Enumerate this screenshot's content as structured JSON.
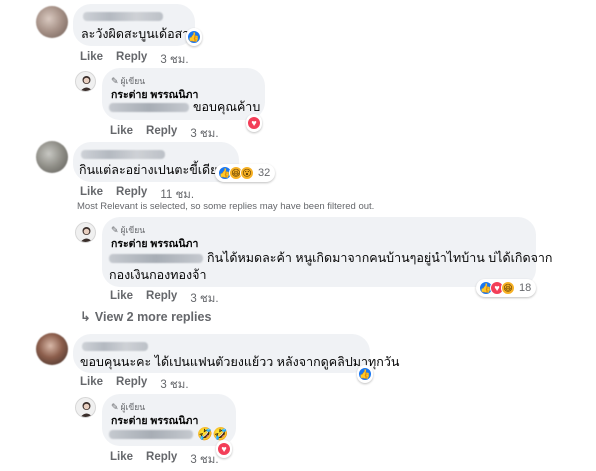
{
  "labels": {
    "like": "Like",
    "reply": "Reply",
    "author_badge": "ผู้เขียน",
    "author_name": "กระต่าย พรรณนิภา"
  },
  "comments": [
    {
      "text": "ละวังผิดสะบูนเด้อสาว",
      "time": "3 ชม.",
      "reactions": [
        "like"
      ],
      "reaction_count": "",
      "reply": {
        "text": "ขอบคุณค้าบ",
        "time": "3 ชม.",
        "reactions": [
          "love"
        ]
      }
    },
    {
      "text": "กินแต่ละอย่างเปนตะขี้เดียด",
      "time": "11 ชม.",
      "reactions": [
        "like",
        "haha",
        "wow"
      ],
      "reaction_count": "32",
      "filter_note": "Most Relevant is selected, so some replies may have been filtered out.",
      "reply": {
        "line1": "กินได้หมดละค้า หนูเกิดมาจากคนบ้านๆอยู่นำไทบ้าน บ่ได้เกิดจาก",
        "line2": "กองเงินกองทองจ้า",
        "time": "3 ชม.",
        "reactions": [
          "like",
          "love",
          "haha"
        ],
        "reaction_count": "18"
      },
      "view_more": "View 2 more replies"
    },
    {
      "text": "ขอบคุนนะคะ ได้เปนแฟนตัวยงแย้วว หลังจากดูคลิปมาทุกวัน",
      "time": "3 ชม.",
      "reactions": [
        "like"
      ],
      "reaction_count": "",
      "reply": {
        "emoji": "🤣🤣",
        "time": "3 ชม.",
        "reactions": [
          "love"
        ]
      }
    }
  ]
}
